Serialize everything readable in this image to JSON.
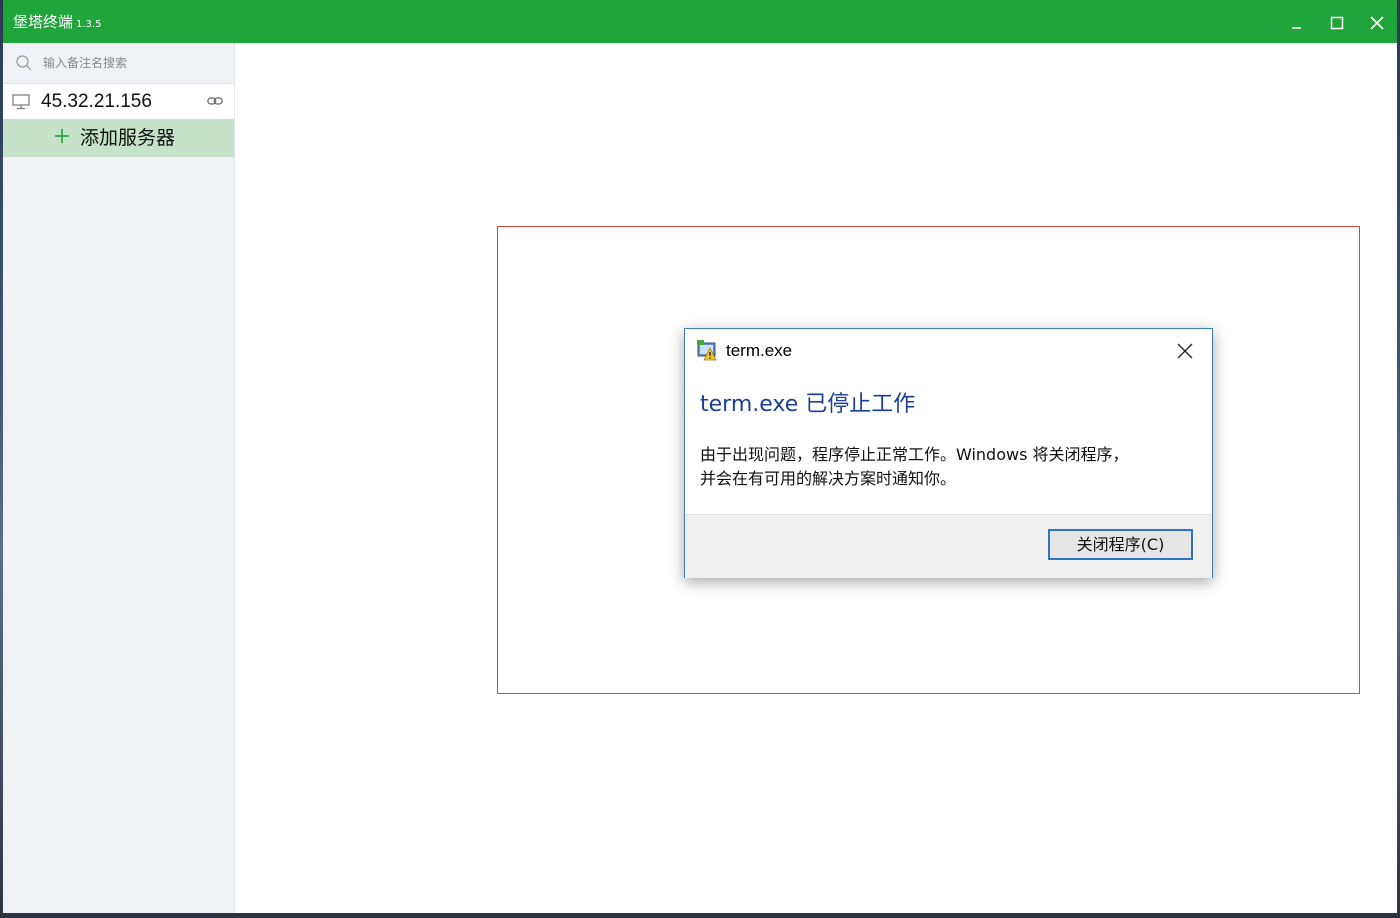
{
  "window": {
    "title": "堡塔终端",
    "version": "1.3.5",
    "titlebar_color": "#20a53a"
  },
  "sidebar": {
    "search_placeholder": "输入备注名搜索",
    "servers": [
      {
        "label": "45.32.21.156",
        "icon": "monitor-icon",
        "status_icon": "link-icon"
      }
    ],
    "add_server_label": "添加服务器",
    "add_server_bg": "#c4e3ca"
  },
  "dialog": {
    "app_title": "term.exe",
    "heading": "term.exe 已停止工作",
    "message_lines": [
      "由于出现问题，程序停止正常工作。Windows 将关闭程序，",
      "并会在有可用的解决方案时通知你。"
    ],
    "button_label": "关闭程序(C)",
    "heading_color": "#1a3f96"
  }
}
